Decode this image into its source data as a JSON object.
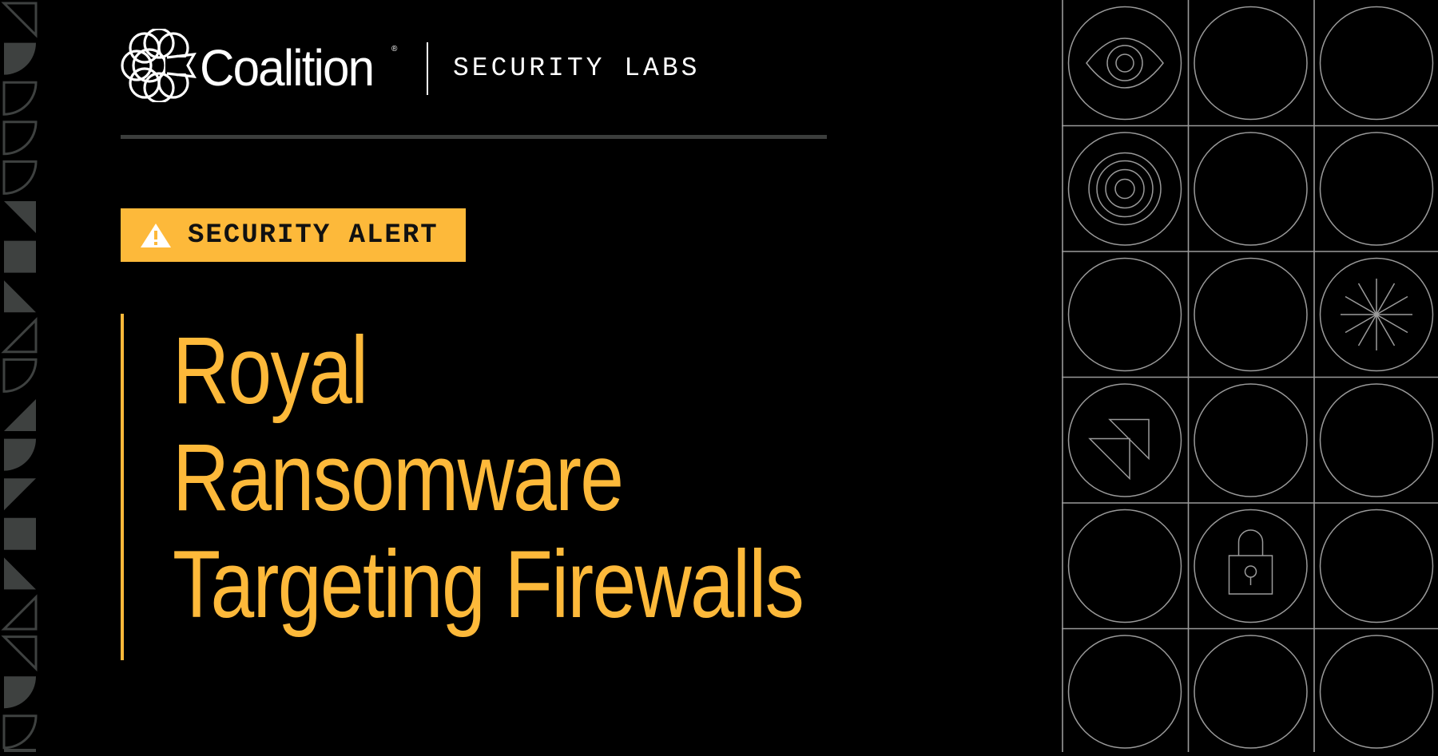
{
  "header": {
    "brand_name": "Coalition",
    "registered_mark": "®",
    "section_label": "SECURITY LABS",
    "logo_icon": "coalition-c-logo-icon"
  },
  "badge": {
    "icon": "warning-triangle-icon",
    "label": "SECURITY ALERT"
  },
  "title": {
    "lines": [
      "Royal",
      "Ransomware",
      "Targeting Firewalls"
    ]
  },
  "decor": {
    "left_strip_shapes": [
      "tri-outline-tr",
      "quarter-filled",
      "quarter-outline",
      "quarter-outline",
      "quarter-outline",
      "tri-filled-tr",
      "square-filled",
      "tri-filled-bl",
      "tri-outline-br",
      "quarter-outline",
      "tri-filled-br",
      "quarter-filled",
      "tri-filled-tl",
      "square-filled",
      "tri-filled-bl",
      "tri-outline-br",
      "tri-outline-tr",
      "quarter-filled",
      "quarter-outline"
    ],
    "grid_icons": [
      [
        "eye-icon",
        "none",
        "none"
      ],
      [
        "target-rings-icon",
        "none",
        "none"
      ],
      [
        "none",
        "none",
        "starburst-icon"
      ],
      [
        "double-arrow-icon",
        "none",
        "none"
      ],
      [
        "none",
        "padlock-icon",
        "none"
      ],
      [
        "none",
        "none",
        "none"
      ]
    ]
  },
  "colors": {
    "background": "#000000",
    "accent": "#fdb93a",
    "divider": "#3b3d3c",
    "strip_shape": "#3e4140",
    "grid_line": "#9a9a9a"
  }
}
